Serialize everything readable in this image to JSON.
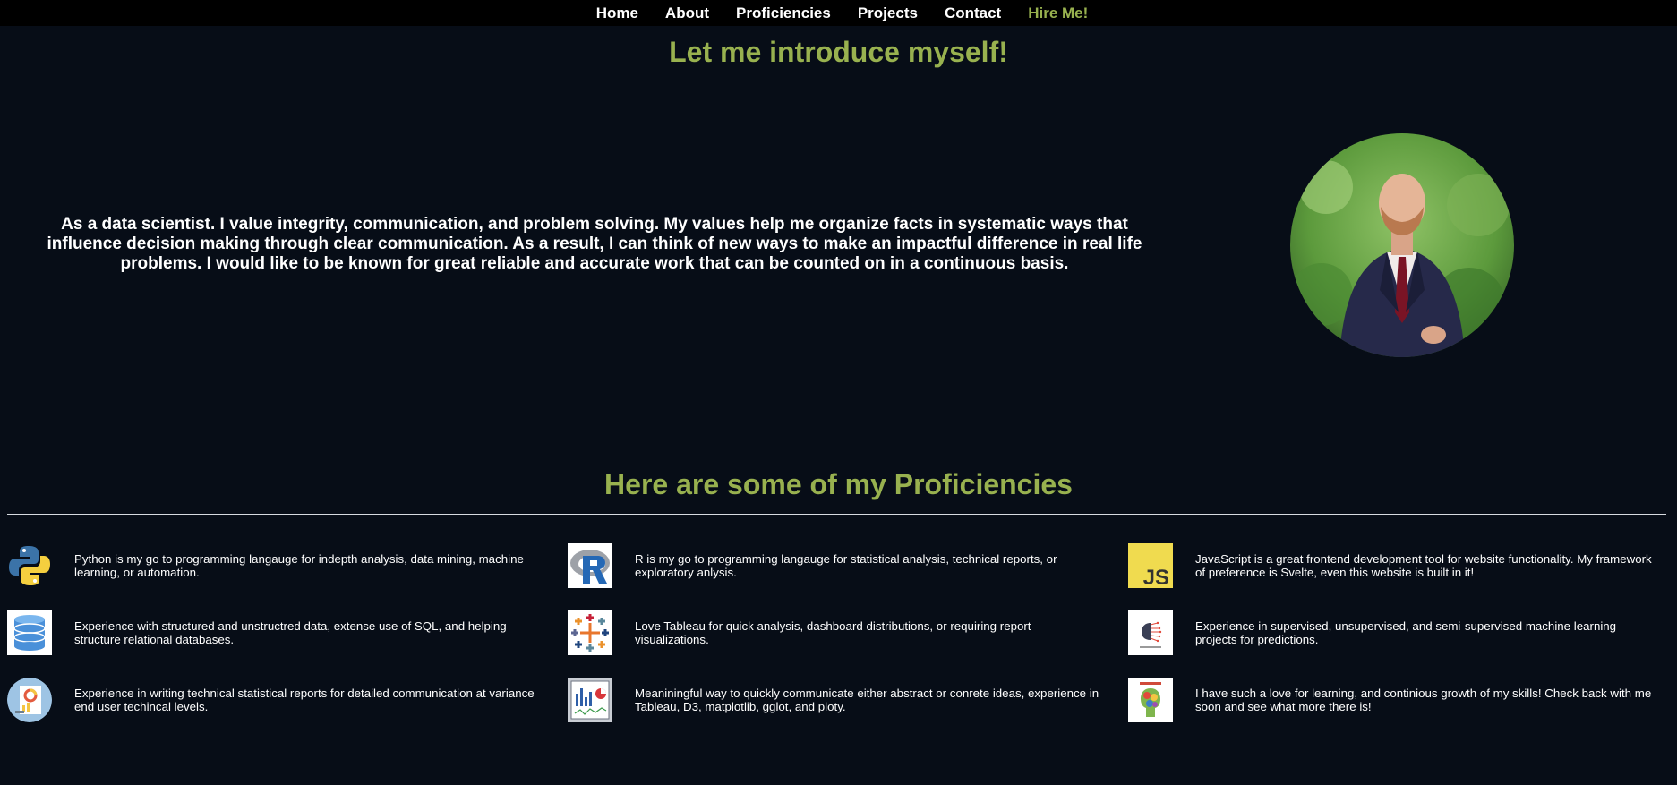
{
  "nav": {
    "items": [
      "Home",
      "About",
      "Proficiencies",
      "Projects",
      "Contact"
    ],
    "hire": "Hire Me!"
  },
  "about": {
    "title": "Let me introduce myself!",
    "text": "As a data scientist. I value integrity, communication, and problem solving. My values help me organize facts in systematic ways that influence decision making through clear communication. As a result, I can think of new ways to make an impactful difference in real life problems. I would like to be known for great reliable and accurate work that can be counted on in a continuous basis."
  },
  "proficiencies": {
    "title": "Here are some of my Proficiencies",
    "items": [
      {
        "icon": "python-icon",
        "text": "Python is my go to programming langauge for indepth analysis, data mining, machine learning, or automation."
      },
      {
        "icon": "r-language-icon",
        "text": "R is my go to programming langauge for statistical analysis, technical reports, or exploratory anlysis."
      },
      {
        "icon": "javascript-icon",
        "text": "JavaScript is a great frontend development tool for website functionality. My framework of preference is Svelte, even this website is built in it!"
      },
      {
        "icon": "database-icon",
        "text": "Experience with structured and unstructred data, extense use of SQL, and helping structure relational databases."
      },
      {
        "icon": "tableau-icon",
        "text": "Love Tableau for quick analysis, dashboard distributions, or requiring report visualizations."
      },
      {
        "icon": "machine-learning-icon",
        "text": "Experience in supervised, unsupervised, and semi-supervised machine learning projects for predictions."
      },
      {
        "icon": "report-icon",
        "text": "Experience in writing technical statistical reports for detailed communication at variance end user techincal levels."
      },
      {
        "icon": "visualization-icon",
        "text": "Meaniningful way to quickly communicate either abstract or conrete ideas, experience in Tableau, D3, matplotlib, gglot, and ploty."
      },
      {
        "icon": "continuous-learning-icon",
        "text": "I have such a love for learning, and continious growth of my skills! Check back with me soon and see what more there is!"
      }
    ]
  },
  "colors": {
    "background": "#070d17",
    "navbar": "#000000",
    "accent": "#98b14f",
    "text": "#ffffff"
  }
}
